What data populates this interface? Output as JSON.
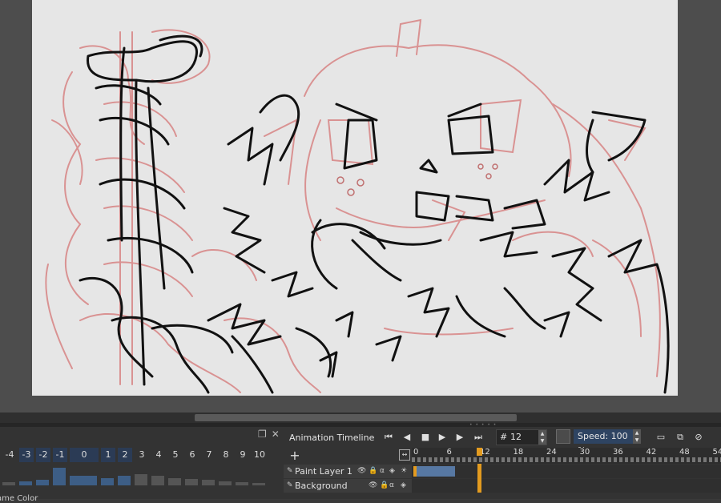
{
  "onion_skin": {
    "label": "ame Color",
    "frames": [
      {
        "label": "-4",
        "opacity": 0.15,
        "selected": false
      },
      {
        "label": "-3",
        "opacity": 0.2,
        "selected": true
      },
      {
        "label": "-2",
        "opacity": 0.25,
        "selected": true
      },
      {
        "label": "-1",
        "opacity": 0.85,
        "selected": true
      },
      {
        "label": "0",
        "opacity": 0.45,
        "selected": true
      },
      {
        "label": "1",
        "opacity": 0.35,
        "selected": true
      },
      {
        "label": "2",
        "opacity": 0.45,
        "selected": true
      },
      {
        "label": "3",
        "opacity": 0.55,
        "selected": false
      },
      {
        "label": "4",
        "opacity": 0.45,
        "selected": false
      },
      {
        "label": "5",
        "opacity": 0.35,
        "selected": false
      },
      {
        "label": "6",
        "opacity": 0.3,
        "selected": false
      },
      {
        "label": "7",
        "opacity": 0.25,
        "selected": false
      },
      {
        "label": "8",
        "opacity": 0.2,
        "selected": false
      },
      {
        "label": "9",
        "opacity": 0.15,
        "selected": false
      },
      {
        "label": "10",
        "opacity": 0.12,
        "selected": false
      }
    ]
  },
  "timeline": {
    "title": "Animation Timeline",
    "current_frame": "12",
    "frame_prefix": "#",
    "speed": "Speed: 100 %",
    "ruler_labels": [
      "0",
      "6",
      "12",
      "18",
      "24",
      "30",
      "36",
      "42",
      "48",
      "54"
    ],
    "layers": [
      {
        "name": "Paint Layer 1"
      },
      {
        "name": "Background"
      }
    ]
  },
  "colors": {
    "sketch_red": "#d88a8a",
    "line_black": "#111111",
    "playhead": "#e39b1f",
    "keyframes": "#5778a3"
  }
}
